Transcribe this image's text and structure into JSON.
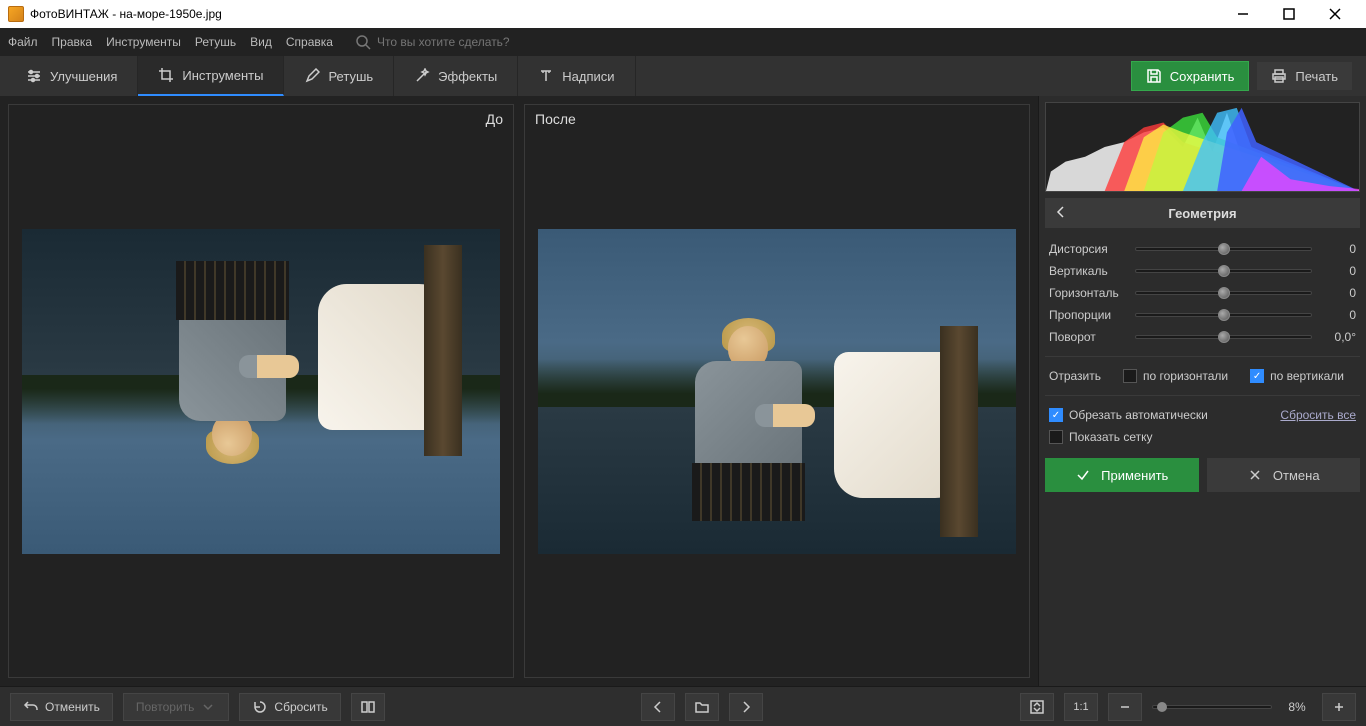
{
  "window": {
    "title": "ФотоВИНТАЖ - на-море-1950е.jpg"
  },
  "menu": {
    "file": "Файл",
    "edit": "Правка",
    "tools": "Инструменты",
    "retouch": "Ретушь",
    "view": "Вид",
    "help": "Справка",
    "search_placeholder": "Что вы хотите сделать?"
  },
  "tabs": {
    "improve": "Улучшения",
    "tools": "Инструменты",
    "retouch": "Ретушь",
    "effects": "Эффекты",
    "captions": "Надписи"
  },
  "actions_top": {
    "save": "Сохранить",
    "print": "Печать"
  },
  "viewer": {
    "before": "До",
    "after": "После"
  },
  "panel": {
    "title": "Геометрия",
    "sliders": [
      {
        "label": "Дисторсия",
        "value": "0"
      },
      {
        "label": "Вертикаль",
        "value": "0"
      },
      {
        "label": "Горизонталь",
        "value": "0"
      },
      {
        "label": "Пропорции",
        "value": "0"
      },
      {
        "label": "Поворот",
        "value": "0,0°"
      }
    ],
    "reflect_label": "Отразить",
    "reflect_h": "по горизонтали",
    "reflect_v": "по вертикали",
    "autocrop": "Обрезать автоматически",
    "show_grid": "Показать сетку",
    "reset": "Сбросить все",
    "apply": "Применить",
    "cancel": "Отмена"
  },
  "footer": {
    "undo": "Отменить",
    "redo": "Повторить",
    "reset": "Сбросить",
    "zoom_value": "8%",
    "ratio": "1:1"
  }
}
